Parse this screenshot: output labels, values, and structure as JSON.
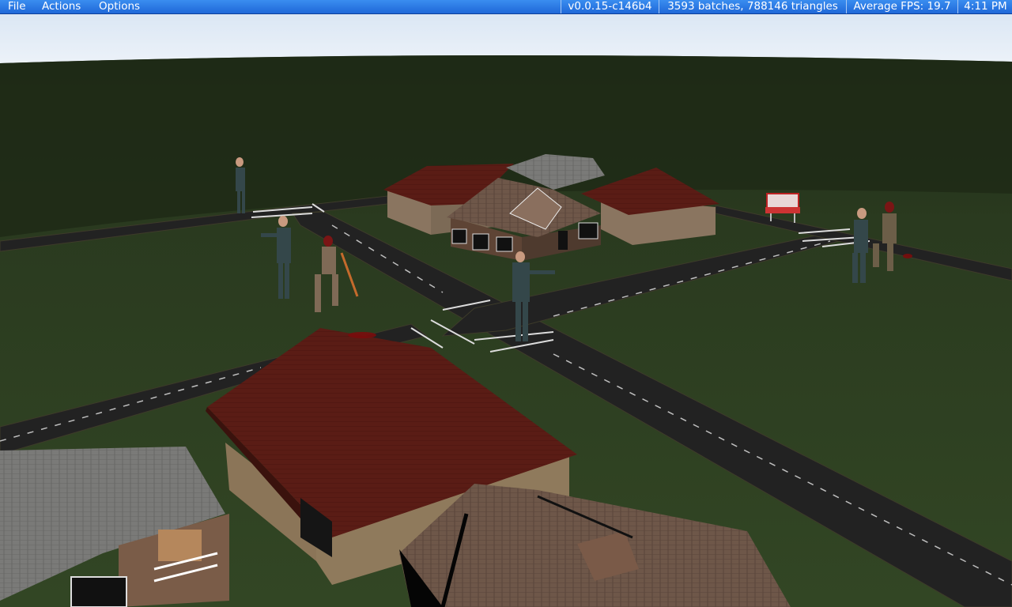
{
  "menu": {
    "file": "File",
    "actions": "Actions",
    "options": "Options"
  },
  "status": {
    "version": "v0.0.15-c146b4",
    "render_stats": "3593 batches, 788146 triangles",
    "fps": "Average FPS: 19.7",
    "clock": "4:11 PM"
  },
  "colors": {
    "menubar": "#2a7ae4",
    "sky": "#dfe9f5",
    "grass": "#2a3b1e",
    "road": "#232323",
    "roof_red": "#5a1c14",
    "roof_shingle": "#6b5445",
    "roof_grey": "#777777"
  }
}
